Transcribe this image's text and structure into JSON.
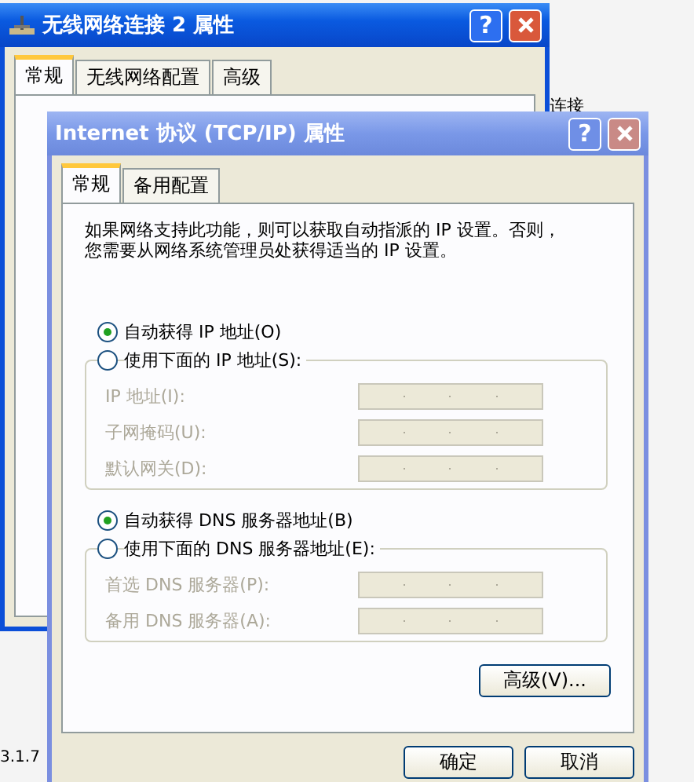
{
  "background_window": {
    "title": "无线网络连接 2 属性",
    "help_button": "?",
    "tabs": [
      {
        "label": "常规",
        "selected": true
      },
      {
        "label": "无线网络配置",
        "selected": false
      },
      {
        "label": "高级",
        "selected": false
      }
    ]
  },
  "desktop_texts": [
    "连接",
    "3.1.7"
  ],
  "dialog": {
    "title": "Internet 协议 (TCP/IP) 属性",
    "help_button": "?",
    "tabs": [
      {
        "label": "常规",
        "selected": true
      },
      {
        "label": "备用配置",
        "selected": false
      }
    ],
    "description_lines": [
      "如果网络支持此功能，则可以获取自动指派的 IP 设置。否则，",
      "您需要从网络系统管理员处获得适当的 IP 设置。"
    ],
    "ip_options": [
      {
        "label": "自动获得 IP 地址(O)",
        "selected": true
      },
      {
        "label": "使用下面的 IP 地址(S):",
        "selected": false
      }
    ],
    "ip_fields": [
      {
        "label": "IP 地址(I):",
        "disabled": true
      },
      {
        "label": "子网掩码(U):",
        "disabled": true
      },
      {
        "label": "默认网关(D):",
        "disabled": true
      }
    ],
    "dns_options": [
      {
        "label": "自动获得 DNS 服务器地址(B)",
        "selected": true
      },
      {
        "label": "使用下面的 DNS 服务器地址(E):",
        "selected": false
      }
    ],
    "dns_fields": [
      {
        "label": "首选 DNS 服务器(P):",
        "disabled": true
      },
      {
        "label": "备用 DNS 服务器(A):",
        "disabled": true
      }
    ],
    "advanced_button": "高级(V)...",
    "buttons": [
      "确定",
      "取消"
    ]
  }
}
